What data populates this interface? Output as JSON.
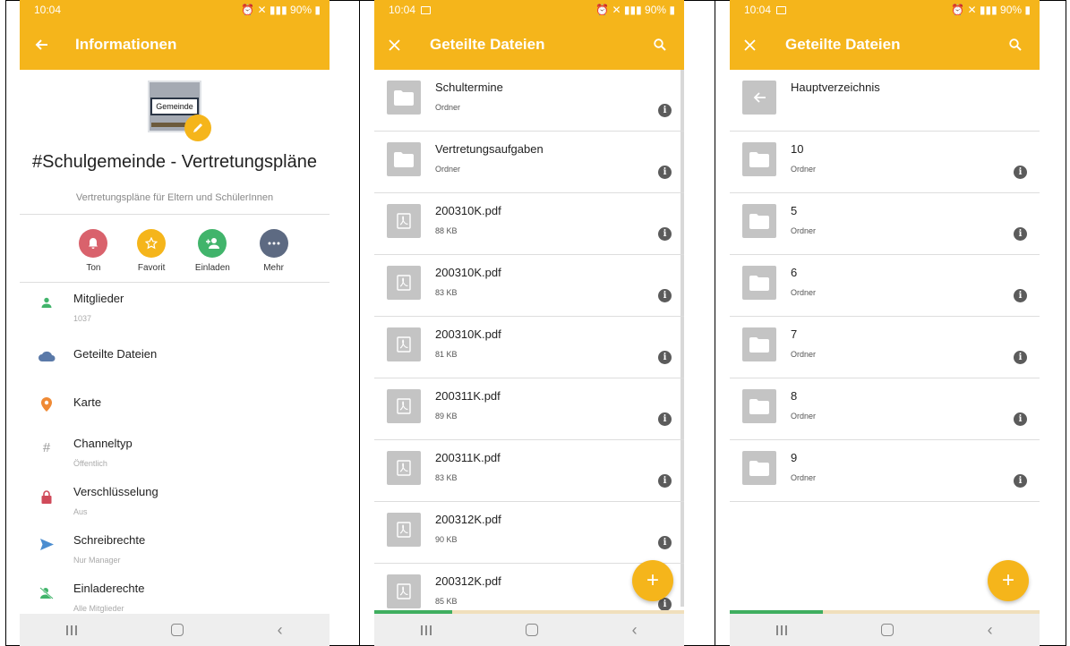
{
  "colors": {
    "accent": "#f5b51b",
    "ton": "#d9626c",
    "favorit": "#f5b51b",
    "einladen": "#41b46b",
    "mehr": "#5d6a82",
    "progress": "#3fae5f"
  },
  "screens": [
    {
      "time": "10:04",
      "status_right": "90%",
      "title": "Informationen",
      "nav_icon": "arrow-back-icon",
      "group": {
        "image_text": "Gemeinde",
        "name": "#Schulgemeinde - Vertretungspläne",
        "description": "Vertretungspläne für Eltern und SchülerInnen"
      },
      "actions": [
        {
          "label": "Ton",
          "icon": "bell-icon"
        },
        {
          "label": "Favorit",
          "icon": "star-icon"
        },
        {
          "label": "Einladen",
          "icon": "add-person-icon"
        },
        {
          "label": "Mehr",
          "icon": "more-icon"
        }
      ],
      "rows": [
        {
          "title": "Mitglieder",
          "subtitle": "1037",
          "icon": "person-icon"
        },
        {
          "title": "Geteilte Dateien",
          "subtitle": "",
          "icon": "cloud-icon"
        },
        {
          "title": "Karte",
          "subtitle": "",
          "icon": "location-pin-icon"
        },
        {
          "title": "Channeltyp",
          "subtitle": "Öffentlich",
          "icon": "hash-icon"
        },
        {
          "title": "Verschlüsselung",
          "subtitle": "Aus",
          "icon": "lock-icon"
        },
        {
          "title": "Schreibrechte",
          "subtitle": "Nur Manager",
          "icon": "send-icon"
        },
        {
          "title": "Einladerechte",
          "subtitle": "Alle Mitglieder",
          "icon": "person-blocked-icon"
        }
      ]
    },
    {
      "time": "10:04",
      "status_right": "90%",
      "title": "Geteilte Dateien",
      "nav_icon": "close-icon",
      "files": [
        {
          "name": "Schultermine",
          "meta": "Ordner",
          "type": "folder"
        },
        {
          "name": "Vertretungsaufgaben",
          "meta": "Ordner",
          "type": "folder"
        },
        {
          "name": "200310K.pdf",
          "meta": "88 KB",
          "type": "pdf"
        },
        {
          "name": "200310K.pdf",
          "meta": "83 KB",
          "type": "pdf"
        },
        {
          "name": "200310K.pdf",
          "meta": "81 KB",
          "type": "pdf"
        },
        {
          "name": "200311K.pdf",
          "meta": "89 KB",
          "type": "pdf"
        },
        {
          "name": "200311K.pdf",
          "meta": "83 KB",
          "type": "pdf"
        },
        {
          "name": "200312K.pdf",
          "meta": "90 KB",
          "type": "pdf"
        },
        {
          "name": "200312K.pdf",
          "meta": "85 KB",
          "type": "pdf"
        }
      ],
      "progress": 0.25
    },
    {
      "time": "10:04",
      "status_right": "90%",
      "title": "Geteilte Dateien",
      "nav_icon": "close-icon",
      "back_row": "Hauptverzeichnis",
      "files": [
        {
          "name": "10",
          "meta": "Ordner",
          "type": "folder"
        },
        {
          "name": "5",
          "meta": "Ordner",
          "type": "folder"
        },
        {
          "name": "6",
          "meta": "Ordner",
          "type": "folder"
        },
        {
          "name": "7",
          "meta": "Ordner",
          "type": "folder"
        },
        {
          "name": "8",
          "meta": "Ordner",
          "type": "folder"
        },
        {
          "name": "9",
          "meta": "Ordner",
          "type": "folder"
        }
      ],
      "progress": 0.3
    }
  ]
}
